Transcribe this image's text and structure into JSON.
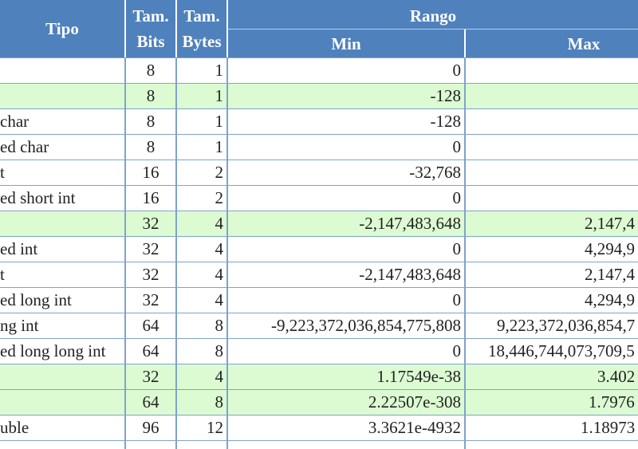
{
  "header": {
    "tipo": "Tipo",
    "tam_bits_1": "Tam.",
    "tam_bits_2": "Bits",
    "tam_bytes_1": "Tam.",
    "tam_bytes_2": "Bytes",
    "rango": "Rango",
    "min": "Min",
    "max": "Max"
  },
  "colors": {
    "header_bg": "#4f81bd",
    "highlight_bg": "#dcfbd2",
    "grid_line": "#7fa3c9"
  },
  "rows": [
    {
      "tipo": "",
      "bits": "8",
      "bytes": "1",
      "min": "0",
      "max": "",
      "highlight": false
    },
    {
      "tipo": "",
      "bits": "8",
      "bytes": "1",
      "min": "-128",
      "max": "",
      "highlight": true
    },
    {
      "tipo": "char",
      "bits": "8",
      "bytes": "1",
      "min": "-128",
      "max": "",
      "highlight": false
    },
    {
      "tipo": "ed char",
      "bits": "8",
      "bytes": "1",
      "min": "0",
      "max": "",
      "highlight": false
    },
    {
      "tipo": "t",
      "bits": "16",
      "bytes": "2",
      "min": "-32,768",
      "max": "",
      "highlight": false
    },
    {
      "tipo": "ed short int",
      "bits": "16",
      "bytes": "2",
      "min": "0",
      "max": "",
      "highlight": false
    },
    {
      "tipo": "",
      "bits": "32",
      "bytes": "4",
      "min": "-2,147,483,648",
      "max": "2,147,4",
      "highlight": true
    },
    {
      "tipo": "ed int",
      "bits": "32",
      "bytes": "4",
      "min": "0",
      "max": "4,294,9",
      "highlight": false
    },
    {
      "tipo": "t",
      "bits": "32",
      "bytes": "4",
      "min": "-2,147,483,648",
      "max": "2,147,4",
      "highlight": false
    },
    {
      "tipo": "ed long int",
      "bits": "32",
      "bytes": "4",
      "min": "0",
      "max": "4,294,9",
      "highlight": false
    },
    {
      "tipo": "ng int",
      "bits": "64",
      "bytes": "8",
      "min": "-9,223,372,036,854,775,808",
      "max": "9,223,372,036,854,7",
      "highlight": false
    },
    {
      "tipo": "ed long long int",
      "bits": "64",
      "bytes": "8",
      "min": "0",
      "max": "18,446,744,073,709,5",
      "highlight": false
    },
    {
      "tipo": "",
      "bits": "32",
      "bytes": "4",
      "min": "1.17549e-38",
      "max": "3.402",
      "highlight": true
    },
    {
      "tipo": "",
      "bits": "64",
      "bytes": "8",
      "min": "2.22507e-308",
      "max": "1.7976",
      "highlight": true
    },
    {
      "tipo": "uble",
      "bits": "96",
      "bytes": "12",
      "min": "3.3621e-4932",
      "max": "1.18973",
      "highlight": false
    }
  ]
}
